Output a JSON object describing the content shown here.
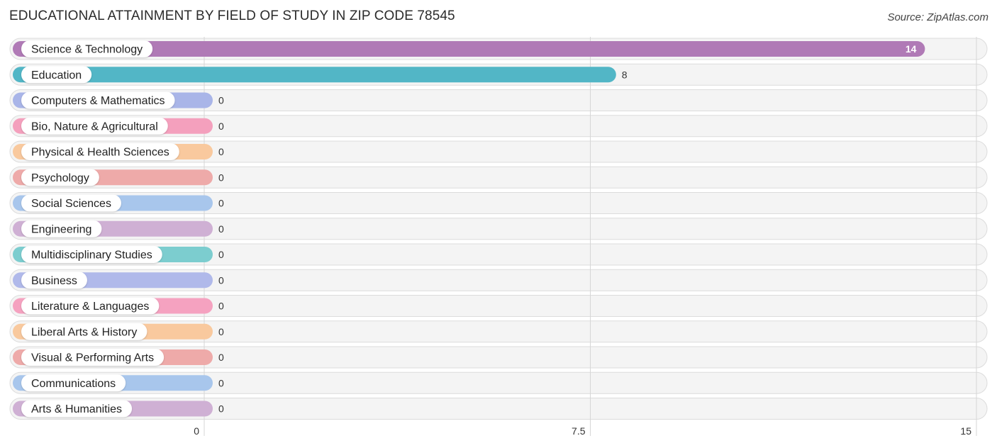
{
  "header": {
    "title": "EDUCATIONAL ATTAINMENT BY FIELD OF STUDY IN ZIP CODE 78545",
    "source": "Source: ZipAtlas.com"
  },
  "chart_data": {
    "type": "bar",
    "orientation": "horizontal",
    "title": "EDUCATIONAL ATTAINMENT BY FIELD OF STUDY IN ZIP CODE 78545",
    "xlabel": "",
    "ylabel": "",
    "xlim": [
      0,
      15
    ],
    "xticks": [
      0,
      7.5,
      15
    ],
    "xtick_labels": [
      "0",
      "7.5",
      "15"
    ],
    "grid": true,
    "categories": [
      "Science & Technology",
      "Education",
      "Computers & Mathematics",
      "Bio, Nature & Agricultural",
      "Physical & Health Sciences",
      "Psychology",
      "Social Sciences",
      "Engineering",
      "Multidisciplinary Studies",
      "Business",
      "Literature & Languages",
      "Liberal Arts & History",
      "Visual & Performing Arts",
      "Communications",
      "Arts & Humanities"
    ],
    "values": [
      14,
      8,
      0,
      0,
      0,
      0,
      0,
      0,
      0,
      0,
      0,
      0,
      0,
      0,
      0
    ],
    "value_labels": [
      "14",
      "8",
      "0",
      "0",
      "0",
      "0",
      "0",
      "0",
      "0",
      "0",
      "0",
      "0",
      "0",
      "0",
      "0"
    ],
    "colors": [
      "#b07ab6",
      "#52b6c6",
      "#a9b5e8",
      "#f4a0bd",
      "#f9c99e",
      "#eeaaa9",
      "#a8c6ec",
      "#cfb0d4",
      "#7ccdcf",
      "#b0b9ea",
      "#f5a2c0",
      "#f9c99e",
      "#eeaaa9",
      "#a8c6ec",
      "#cfb0d4"
    ]
  }
}
